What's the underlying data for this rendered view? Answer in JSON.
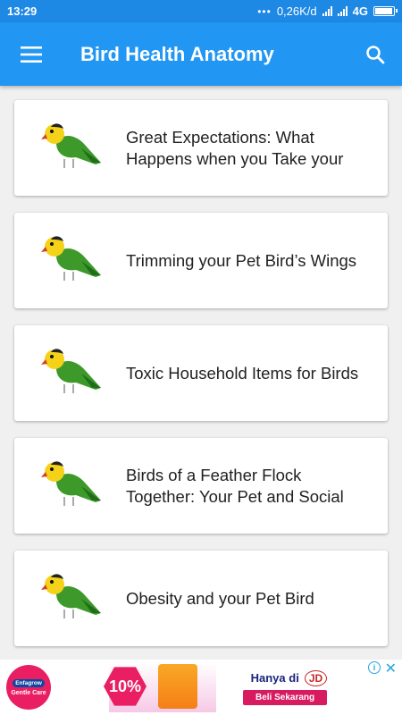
{
  "status_bar": {
    "time": "13:29",
    "dots": "•••",
    "speed": "0,26K/d",
    "network": "4G"
  },
  "app_bar": {
    "title": "Bird Health Anatomy",
    "menu_icon": "hamburger-menu-icon",
    "search_icon": "search-icon"
  },
  "articles": [
    {
      "title": "Great Expectations: What Happens when you Take your"
    },
    {
      "title": "Trimming your Pet Bird’s Wings"
    },
    {
      "title": "Toxic Household Items for Birds"
    },
    {
      "title": "Birds of a Feather Flock Together: Your Pet and Social"
    },
    {
      "title": "Obesity and your Pet Bird"
    }
  ],
  "ad": {
    "brand": "Enfagrow",
    "logo_sub": "Gentle Care",
    "percent": "10%",
    "headline": "Hanya di",
    "store": "JD",
    "cta": "Beli Sekarang",
    "info_icon": "info-icon",
    "close_icon": "close-icon"
  },
  "colors": {
    "status_bar": "#1e88e5",
    "app_bar": "#2196f3",
    "background": "#f0f0f0",
    "card": "#ffffff"
  }
}
